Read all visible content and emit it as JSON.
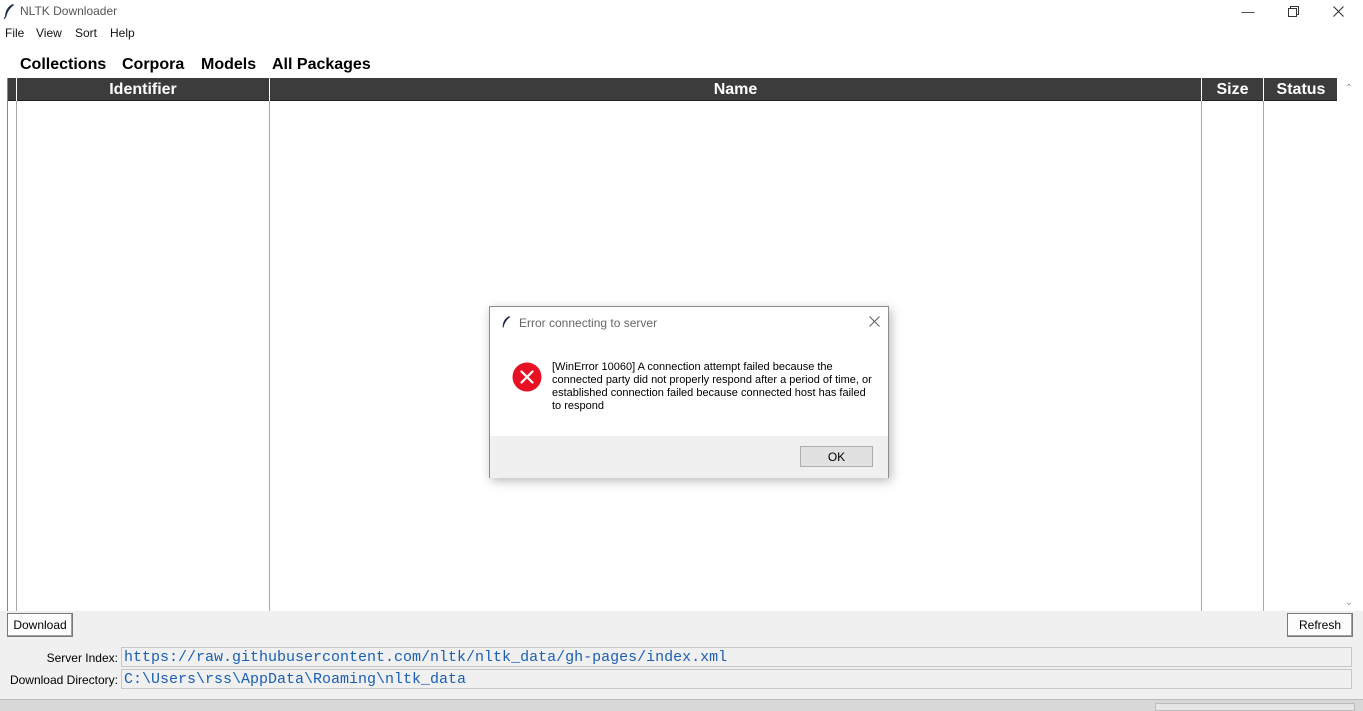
{
  "window": {
    "title": "NLTK Downloader",
    "minimize_icon": "minimize-icon",
    "restore_icon": "restore-icon",
    "close_icon": "close-icon"
  },
  "menu": {
    "items": [
      "File",
      "View",
      "Sort",
      "Help"
    ]
  },
  "tabs": [
    "Collections",
    "Corpora",
    "Models",
    "All Packages"
  ],
  "table": {
    "columns": [
      "Identifier",
      "Name",
      "Size",
      "Status"
    ],
    "rows": []
  },
  "buttons": {
    "download": "Download",
    "refresh": "Refresh"
  },
  "fields": {
    "server_index_label": "Server Index:",
    "server_index_value": "https://raw.githubusercontent.com/nltk/nltk_data/gh-pages/index.xml",
    "download_dir_label": "Download Directory:",
    "download_dir_value": "C:\\Users\\rss\\AppData\\Roaming\\nltk_data"
  },
  "dialog": {
    "title": "Error connecting to server",
    "message": "[WinError 10060] A connection attempt failed because the connected party did not properly respond after a period of time, or established connection failed because connected host has failed to respond",
    "ok_label": "OK",
    "icon": "error-icon"
  },
  "colors": {
    "header_bg": "#3c3c3c",
    "link_text": "#1a5fb4",
    "error_red": "#e81123"
  }
}
